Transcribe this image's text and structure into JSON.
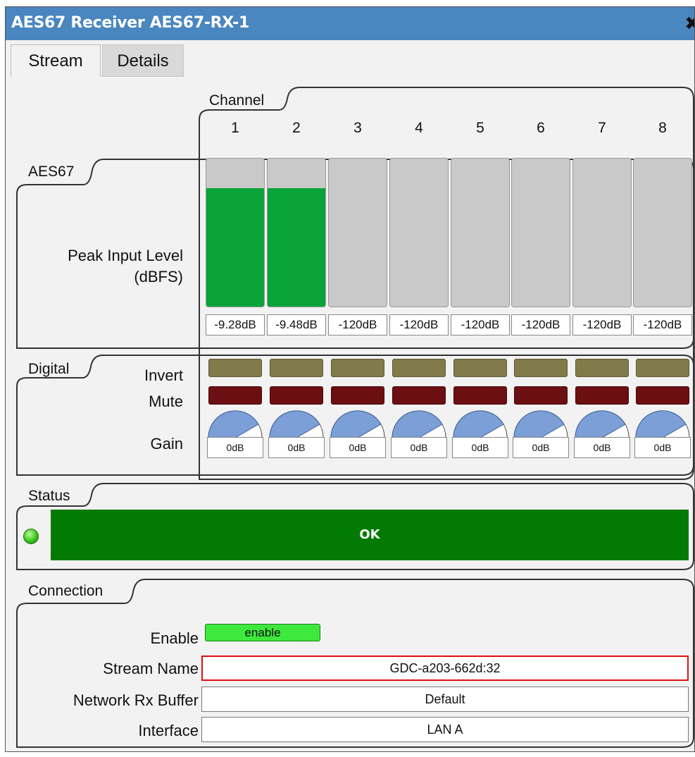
{
  "window": {
    "title": "AES67 Receiver AES67-RX-1"
  },
  "tabs": [
    {
      "label": "Stream",
      "active": true
    },
    {
      "label": "Details",
      "active": false
    }
  ],
  "groups": {
    "channel": "Channel",
    "aes67": "AES67",
    "digital": "Digital",
    "status": "Status",
    "connection": "Connection"
  },
  "labels": {
    "peak_input_level": "Peak Input Level",
    "peak_unit": "(dBFS)",
    "invert": "Invert",
    "mute": "Mute",
    "gain": "Gain",
    "enable": "Enable",
    "stream_name": "Stream Name",
    "network_rx_buffer": "Network Rx Buffer",
    "interface": "Interface"
  },
  "channels": [
    {
      "number": "1",
      "peak": "-9.28dB",
      "level_fraction": 0.8,
      "gain": "0dB"
    },
    {
      "number": "2",
      "peak": "-9.48dB",
      "level_fraction": 0.8,
      "gain": "0dB"
    },
    {
      "number": "3",
      "peak": "-120dB",
      "level_fraction": 0.0,
      "gain": "0dB"
    },
    {
      "number": "4",
      "peak": "-120dB",
      "level_fraction": 0.0,
      "gain": "0dB"
    },
    {
      "number": "5",
      "peak": "-120dB",
      "level_fraction": 0.0,
      "gain": "0dB"
    },
    {
      "number": "6",
      "peak": "-120dB",
      "level_fraction": 0.0,
      "gain": "0dB"
    },
    {
      "number": "7",
      "peak": "-120dB",
      "level_fraction": 0.0,
      "gain": "0dB"
    },
    {
      "number": "8",
      "peak": "-120dB",
      "level_fraction": 0.0,
      "gain": "0dB"
    }
  ],
  "status": {
    "text": "OK",
    "led": "green"
  },
  "connection": {
    "enable_button": "enable",
    "stream_name": "GDC-a203-662d:32",
    "network_rx_buffer": "Default",
    "interface": "LAN A"
  },
  "colors": {
    "titlebar": "#4a86c0",
    "meter_fill": "#0aa33a",
    "invert": "#817a4a",
    "mute": "#6b0f13",
    "knob": "#7b9fd6",
    "status_ok": "#037a03",
    "enable_on": "#3de93d",
    "stream_name_border": "#e01010"
  },
  "icons": {
    "close": "close-icon",
    "led": "status-led-icon"
  }
}
